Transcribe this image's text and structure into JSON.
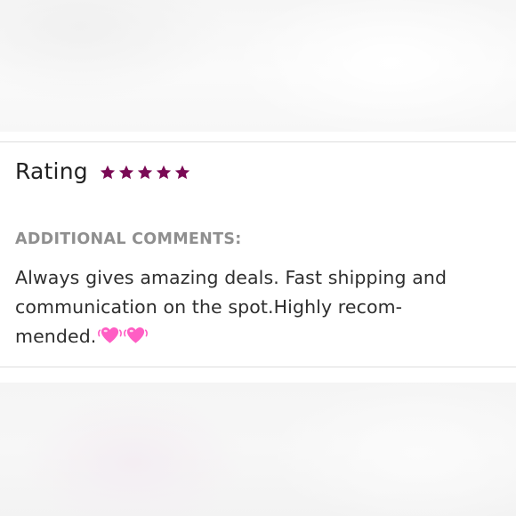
{
  "review": {
    "rating_label": "Rating",
    "rating_value": 5,
    "rating_max": 5,
    "star_color": "#7a0a55",
    "comments_heading": "ADDITIONAL COMMENTS:",
    "comment_line1": "Always gives amazing deals. Fast shipping and",
    "comment_line2": "communication on the spot.Highly recom-",
    "comment_line3": "mended.",
    "emoji_icons": [
      "growing-heart-icon",
      "growing-heart-icon"
    ],
    "heart_color": "#ff5ec4"
  }
}
